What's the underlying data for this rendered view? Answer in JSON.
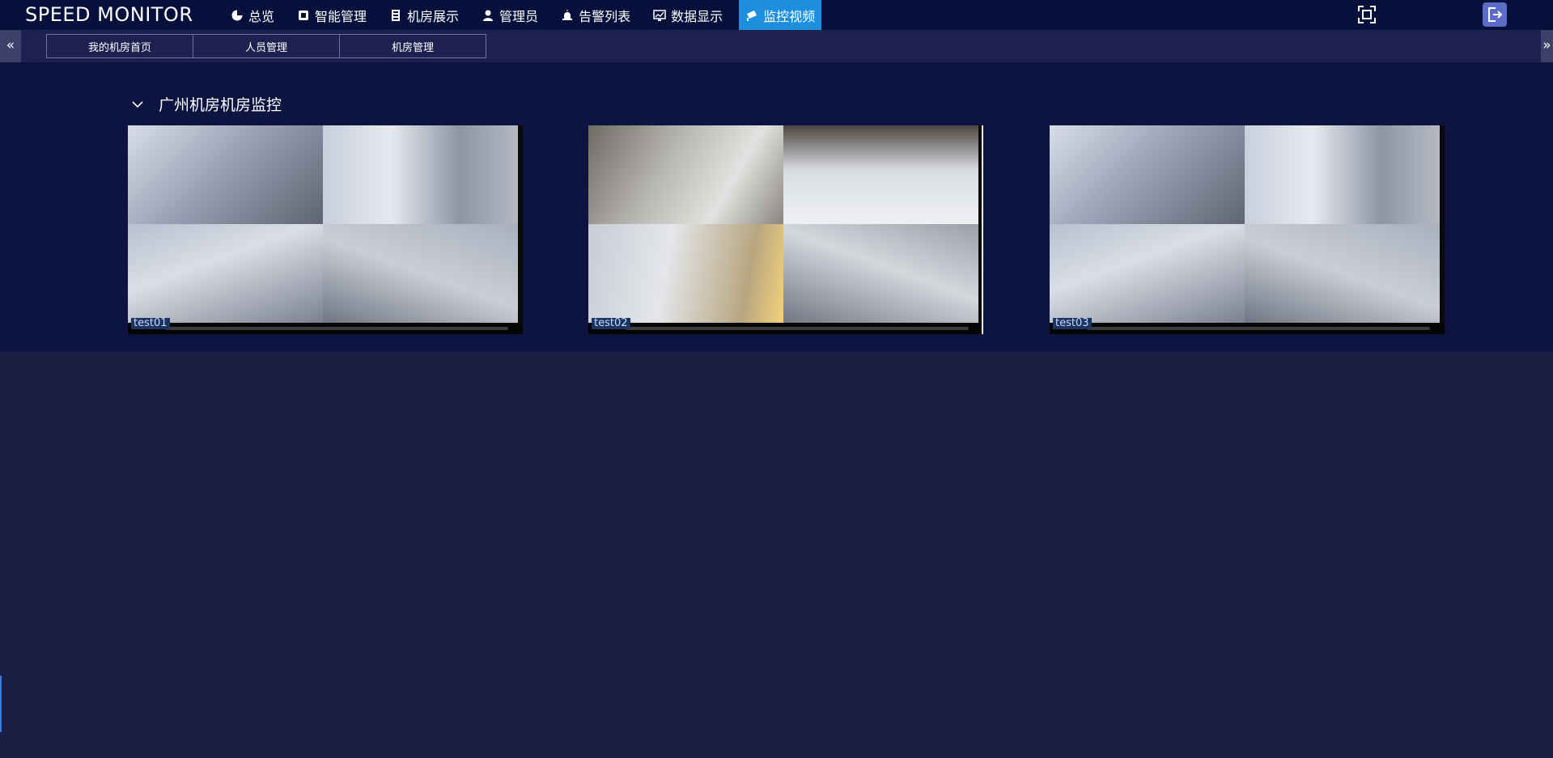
{
  "app": {
    "title": "SPEED MONITOR"
  },
  "nav": {
    "items": [
      {
        "label": "总览",
        "icon": "pie-chart-icon"
      },
      {
        "label": "智能管理",
        "icon": "chip-icon"
      },
      {
        "label": "机房展示",
        "icon": "server-icon"
      },
      {
        "label": "管理员",
        "icon": "user-icon"
      },
      {
        "label": "告警列表",
        "icon": "alarm-icon"
      },
      {
        "label": "数据显示",
        "icon": "monitor-chart-icon"
      },
      {
        "label": "监控视频",
        "icon": "camera-icon",
        "active": true
      }
    ]
  },
  "tabs": [
    {
      "label": "我的机房首页"
    },
    {
      "label": "人员管理"
    },
    {
      "label": "机房管理"
    }
  ],
  "section": {
    "title": "广州机房机房监控"
  },
  "cameras": [
    {
      "label": "test01"
    },
    {
      "label": "test02"
    },
    {
      "label": "test03"
    }
  ],
  "colors": {
    "topbar": "#06103a",
    "active_nav": "#1e8fde",
    "background": "#1a1f44",
    "panel": "#0d1440"
  }
}
